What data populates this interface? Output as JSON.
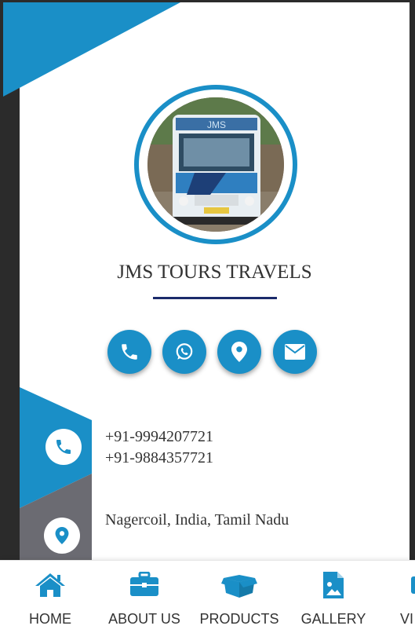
{
  "business": {
    "name": "JMS TOURS TRAVELS",
    "avatar_alt": "Bus photo"
  },
  "actions": [
    {
      "id": "call",
      "icon": "phone-icon"
    },
    {
      "id": "whatsapp",
      "icon": "whatsapp-icon"
    },
    {
      "id": "location",
      "icon": "map-pin-icon"
    },
    {
      "id": "email",
      "icon": "envelope-icon"
    }
  ],
  "contact": {
    "phone1": "+91-9994207721",
    "phone2": "+91-9884357721",
    "address": "Nagercoil, India, Tamil Nadu"
  },
  "nav": {
    "items": [
      {
        "label": "HOME",
        "icon": "home-icon"
      },
      {
        "label": "ABOUT US",
        "icon": "briefcase-icon"
      },
      {
        "label": "PRODUCTS",
        "icon": "box-icon"
      },
      {
        "label": "GALLERY",
        "icon": "image-file-icon"
      },
      {
        "label": "VI",
        "icon": "video-icon"
      }
    ]
  },
  "colors": {
    "accent": "#1a8fc7",
    "dark_frame": "#2b2b2b",
    "gray_panel": "#6b6b72",
    "underline": "#1b2a6b"
  }
}
